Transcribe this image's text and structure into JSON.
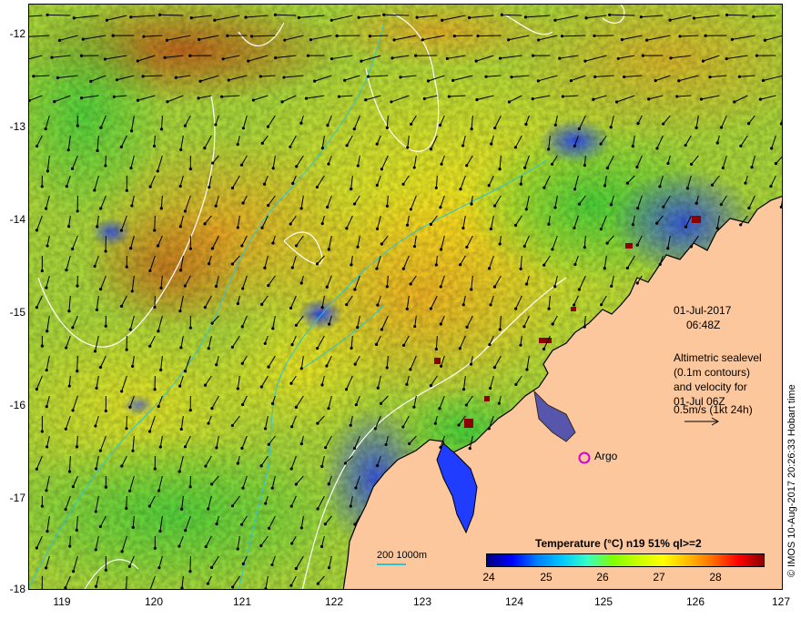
{
  "map": {
    "lon_ticks": [
      "119",
      "120",
      "121",
      "122",
      "123",
      "124",
      "125",
      "126",
      "127"
    ],
    "lat_ticks": [
      "-12",
      "-13",
      "-14",
      "-15",
      "-16",
      "-17",
      "-18"
    ],
    "lon_range": [
      118.6,
      127.0
    ],
    "lat_range": [
      -18.0,
      -11.7
    ]
  },
  "overlay": {
    "date": "01-Jul-2017",
    "time": "06:48Z",
    "legend_line1": "Altimetric sealevel",
    "legend_line2": "(0.1m contours)",
    "legend_line3": "and velocity for",
    "legend_line4": "01-Jul 06Z",
    "legend_line5": "0.5m/s (1kt 24h)",
    "argo_label": "Argo",
    "depth_legend": "200  1000m"
  },
  "colorbar": {
    "title": "Temperature (°C) n19 51% ql>=2",
    "ticks": [
      "24",
      "25",
      "26",
      "27",
      "28"
    ],
    "range": [
      24,
      28.8
    ],
    "colors": [
      "#00007f",
      "#0000ff",
      "#007fff",
      "#00c8ff",
      "#37ffc4",
      "#7fff00",
      "#c8ff00",
      "#ffff00",
      "#ffbb00",
      "#ff6a00",
      "#ff0000",
      "#8b0000"
    ]
  },
  "credit": "© IMOS 10-Aug-2017 20:26:33 Hobart time",
  "colors": {
    "land": "#fcc79c",
    "coast": "#000000",
    "sea_level_contour": "#ffffff",
    "bathymetry_contour": "#2ec4d6",
    "argo_marker": "#d400d4"
  }
}
